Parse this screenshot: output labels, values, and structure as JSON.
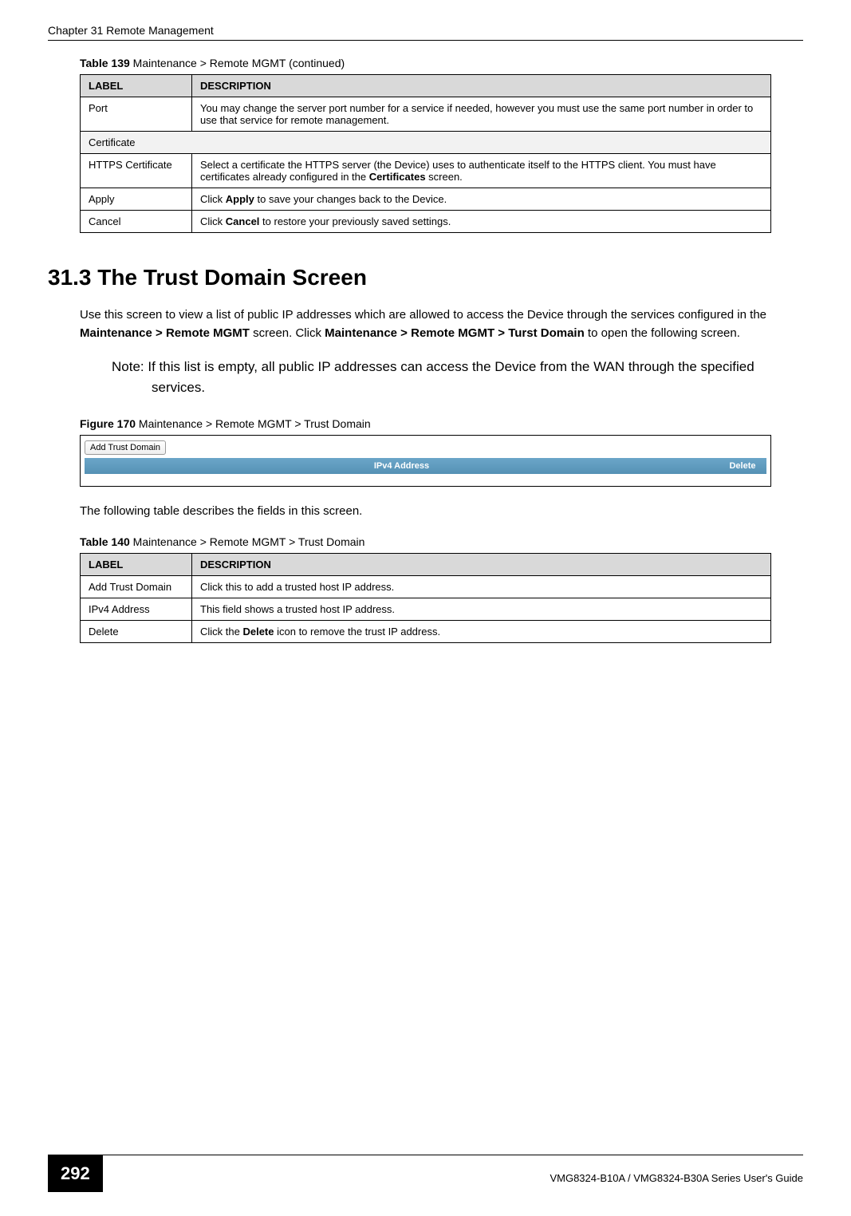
{
  "header": {
    "chapter": "Chapter 31 Remote Management"
  },
  "table139": {
    "caption_prefix": "Table 139",
    "caption_rest": "   Maintenance > Remote MGMT  (continued)",
    "col1": "LABEL",
    "col2": "DESCRIPTION",
    "rows": [
      {
        "label": "Port",
        "desc": "You may change the server port number for a service if needed, however you must use the same port number in order to use that service for remote management."
      },
      {
        "label": "Certificate",
        "desc": "",
        "section": true
      },
      {
        "label": "HTTPS Certificate",
        "desc_pre": "Select a certificate the HTTPS server (the Device) uses to authenticate itself to the HTTPS client. You must have certificates already configured in the ",
        "desc_bold": "Certificates",
        "desc_post": " screen."
      },
      {
        "label": "Apply",
        "desc_pre": "Click ",
        "desc_bold": "Apply",
        "desc_post": " to save your changes back to the Device."
      },
      {
        "label": "Cancel",
        "desc_pre": "Click ",
        "desc_bold": "Cancel",
        "desc_post": " to restore your previously saved settings."
      }
    ]
  },
  "section": {
    "heading": "31.3  The Trust Domain Screen",
    "para1_pre": "Use this screen to view a list of public IP addresses which are allowed to access the Device through the services configured in the ",
    "para1_b1": "Maintenance > Remote MGMT",
    "para1_mid": " screen. Click ",
    "para1_b2": "Maintenance > Remote MGMT > Turst Domain",
    "para1_post": " to open the following screen.",
    "note": "Note: If this list is empty, all public IP addresses can access the Device from the WAN through the specified services."
  },
  "figure170": {
    "caption_prefix": "Figure 170",
    "caption_rest": "   Maintenance > Remote MGMT > Trust Domain",
    "button": "Add Trust Domain",
    "col_addr": "IPv4 Address",
    "col_del": "Delete"
  },
  "paragraph_after_figure": "The following table describes the fields in this screen.",
  "table140": {
    "caption_prefix": "Table 140",
    "caption_rest": "   Maintenance > Remote MGMT > Trust Domain",
    "col1": "LABEL",
    "col2": "DESCRIPTION",
    "rows": [
      {
        "label": "Add Trust Domain",
        "desc": "Click this to add a trusted host IP address."
      },
      {
        "label": "IPv4 Address",
        "desc": "This field shows a trusted host IP address."
      },
      {
        "label": "Delete",
        "desc_pre": "Click the ",
        "desc_bold": "Delete",
        "desc_post": " icon to remove the trust IP address."
      }
    ]
  },
  "footer": {
    "page": "292",
    "guide": "VMG8324-B10A / VMG8324-B30A Series User's Guide"
  }
}
